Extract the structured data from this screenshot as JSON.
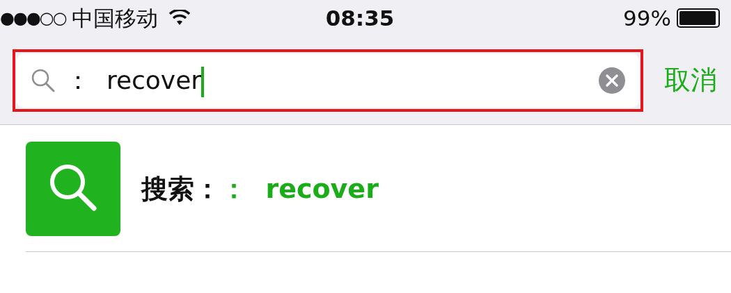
{
  "status_bar": {
    "signal": "●●●○○",
    "carrier": "中国移动",
    "time": "08:35",
    "battery": "99%"
  },
  "search": {
    "value": "：  recover",
    "highlighted": true,
    "cancel": "取消"
  },
  "results": [
    {
      "label": "搜索：",
      "query": "：  recover"
    }
  ]
}
